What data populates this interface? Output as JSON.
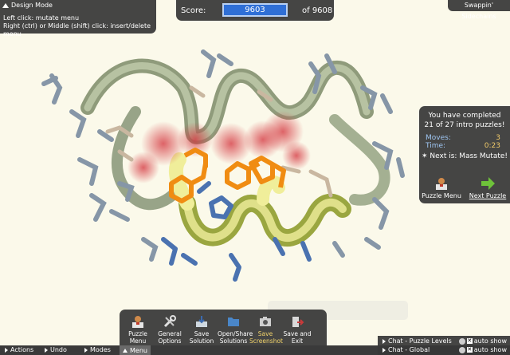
{
  "design": {
    "mode": "Design Mode",
    "line1": "Left click: mutate menu",
    "line2": "Right (ctrl) or Middle (shift) click: insert/delete menu"
  },
  "score": {
    "label": "Score:",
    "value": "9603",
    "of": "of 9608"
  },
  "puzzle": {
    "name": "Swappin' Sidechains"
  },
  "complete": {
    "line1": "You have completed",
    "line2": "21 of 27 intro puzzles!",
    "moves_label": "Moves:",
    "moves_value": "3",
    "time_label": "Time:",
    "time_value": "0:23",
    "next_label": "Next is: Mass Mutate!",
    "puzzle_menu": "Puzzle Menu",
    "next_puzzle": "Next Puzzle"
  },
  "toolbar": [
    {
      "line1": "Puzzle",
      "line2": "Menu",
      "icon": "puzzle-menu-icon"
    },
    {
      "line1": "General",
      "line2": "Options",
      "icon": "wrench-icon"
    },
    {
      "line1": "Save",
      "line2": "Solution",
      "icon": "save-solution-icon"
    },
    {
      "line1": "Open/Share",
      "line2": "Solutions",
      "icon": "folder-icon"
    },
    {
      "line1": "Save",
      "line2": "Screenshot",
      "icon": "camera-icon"
    },
    {
      "line1": "Save and",
      "line2": "Exit",
      "icon": "exit-icon"
    }
  ],
  "bottom": {
    "actions": "Actions",
    "undo": "Undo",
    "modes": "Modes",
    "menu": "Menu"
  },
  "chat": {
    "levels": "Chat - Puzzle Levels",
    "global": "Chat - Global",
    "auto_show": "auto show"
  },
  "colors": {
    "panel": "#373737",
    "score_field": "#2f6fd6",
    "moves_label": "#9fc6f3",
    "moves_value": "#f0ca6a",
    "background": "#fbf9ea"
  }
}
